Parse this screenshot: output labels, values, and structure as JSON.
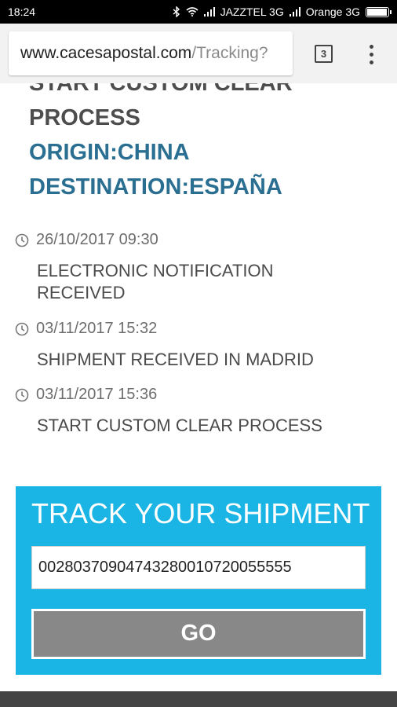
{
  "status_bar": {
    "time": "18:24",
    "carrier1": "JAZZTEL 3G",
    "carrier2": "Orange 3G",
    "battery_level": 0.95
  },
  "browser": {
    "url_host": "www.cacesapostal.com",
    "url_path": "/Tracking?",
    "tab_count": "3"
  },
  "header": {
    "status": "START CUSTOM CLEAR PROCESS",
    "status_line1": "START CUSTOM CLEAR",
    "status_line2": "PROCESS",
    "origin": "ORIGIN:CHINA",
    "destination": "DESTINATION:ESPAÑA"
  },
  "events": [
    {
      "date": "26/10/2017 09:30",
      "desc": "ELECTRONIC NOTIFICATION RECEIVED"
    },
    {
      "date": "03/11/2017 15:32",
      "desc": "SHIPMENT RECEIVED IN MADRID"
    },
    {
      "date": "03/11/2017 15:36",
      "desc": "START CUSTOM CLEAR PROCESS"
    }
  ],
  "track": {
    "title": "TRACK YOUR SHIPMENT",
    "tracking_number": "00280370904743280010720055555",
    "go_label": "GO"
  },
  "colors": {
    "track_panel": "#1bb5e5",
    "heading_blue": "#2a6f92",
    "go_button": "#888888"
  }
}
